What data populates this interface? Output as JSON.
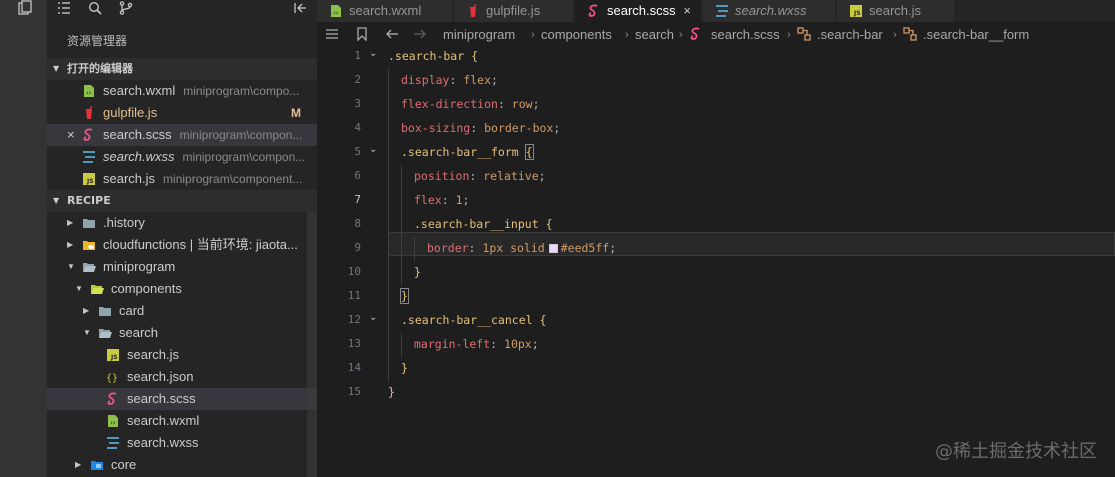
{
  "activity_bar": {
    "icons": [
      "files-icon",
      "list-icon",
      "search-icon",
      "source-control-icon"
    ]
  },
  "sidebar": {
    "title": "资源管理器",
    "open_editors_label": "打开的编辑器",
    "open_editors": [
      {
        "name": "search.wxml",
        "path": "miniprogram\\compo...",
        "icon": "wxml-icon"
      },
      {
        "name": "gulpfile.js",
        "path": "",
        "icon": "gulp-icon",
        "status": "M"
      },
      {
        "name": "search.scss",
        "path": "miniprogram\\compon...",
        "icon": "scss-icon",
        "close": "×"
      },
      {
        "name": "search.wxss",
        "path": "miniprogram\\compon...",
        "icon": "wxss-icon"
      },
      {
        "name": "search.js",
        "path": "miniprogram\\component...",
        "icon": "js-icon"
      }
    ],
    "project_label": "RECIPE",
    "tree": [
      {
        "name": ".history",
        "type": "folder",
        "expanded": false
      },
      {
        "name": "cloudfunctions | 当前环境: jiaota...",
        "type": "cloud-folder",
        "expanded": false
      },
      {
        "name": "miniprogram",
        "type": "folder",
        "expanded": true
      },
      {
        "name": "components",
        "type": "components-folder",
        "expanded": true
      },
      {
        "name": "card",
        "type": "folder",
        "expanded": false
      },
      {
        "name": "search",
        "type": "folder",
        "expanded": true
      },
      {
        "name": "search.js",
        "type": "js"
      },
      {
        "name": "search.json",
        "type": "json"
      },
      {
        "name": "search.scss",
        "type": "scss"
      },
      {
        "name": "search.wxml",
        "type": "wxml"
      },
      {
        "name": "search.wxss",
        "type": "wxss"
      },
      {
        "name": "core",
        "type": "core-folder",
        "expanded": false
      }
    ]
  },
  "tabs": [
    {
      "name": "search.wxml",
      "icon": "wxml-icon"
    },
    {
      "name": "gulpfile.js",
      "icon": "gulp-icon"
    },
    {
      "name": "search.scss",
      "icon": "scss-icon",
      "close": "×"
    },
    {
      "name": "search.wxss",
      "icon": "wxss-icon"
    },
    {
      "name": "search.js",
      "icon": "js-icon"
    }
  ],
  "breadcrumb": {
    "items": [
      "miniprogram",
      "components",
      "search",
      "search.scss",
      ".search-bar",
      ".search-bar__form"
    ]
  },
  "code": {
    "line_numbers": [
      "1",
      "2",
      "3",
      "4",
      "5",
      "6",
      "7",
      "8",
      "9",
      "10",
      "11",
      "12",
      "13",
      "14",
      "15"
    ],
    "lines": [
      [
        {
          "t": ".search-bar ",
          "c": "sel"
        },
        {
          "t": "{",
          "c": "brace"
        }
      ],
      [
        {
          "t": "display",
          "c": "prop"
        },
        {
          "t": ": ",
          "c": "pun"
        },
        {
          "t": "flex",
          "c": "val"
        },
        {
          "t": ";",
          "c": "pun"
        }
      ],
      [
        {
          "t": "flex-direction",
          "c": "prop"
        },
        {
          "t": ": ",
          "c": "pun"
        },
        {
          "t": "row",
          "c": "val"
        },
        {
          "t": ";",
          "c": "pun"
        }
      ],
      [
        {
          "t": "box-sizing",
          "c": "prop"
        },
        {
          "t": ": ",
          "c": "pun"
        },
        {
          "t": "border-box",
          "c": "val"
        },
        {
          "t": ";",
          "c": "pun"
        }
      ],
      [
        {
          "t": ".search-bar__form ",
          "c": "sel"
        },
        {
          "t": "{",
          "c": "brace"
        }
      ],
      [
        {
          "t": "position",
          "c": "prop"
        },
        {
          "t": ": ",
          "c": "pun"
        },
        {
          "t": "relative",
          "c": "val"
        },
        {
          "t": ";",
          "c": "pun"
        }
      ],
      [
        {
          "t": "flex",
          "c": "prop"
        },
        {
          "t": ": ",
          "c": "pun"
        },
        {
          "t": "1",
          "c": "val"
        },
        {
          "t": ";",
          "c": "pun"
        }
      ],
      [
        {
          "t": ".search-bar__input ",
          "c": "sel"
        },
        {
          "t": "{",
          "c": "brace"
        }
      ],
      [
        {
          "t": "border",
          "c": "prop"
        },
        {
          "t": ": ",
          "c": "pun"
        },
        {
          "t": "1px solid",
          "c": "val"
        },
        {
          "t": "#eed5ff",
          "c": "swatch-val"
        },
        {
          "t": ";",
          "c": "pun"
        }
      ],
      [
        {
          "t": "}",
          "c": "brace"
        }
      ],
      [
        {
          "t": "}",
          "c": "brace"
        }
      ],
      [
        {
          "t": ".search-bar__cancel ",
          "c": "sel"
        },
        {
          "t": "{",
          "c": "brace"
        }
      ],
      [
        {
          "t": "margin-left",
          "c": "prop"
        },
        {
          "t": ": ",
          "c": "pun"
        },
        {
          "t": "10px",
          "c": "val"
        },
        {
          "t": ";",
          "c": "pun"
        }
      ],
      [
        {
          "t": "}",
          "c": "brace"
        }
      ],
      [
        {
          "t": "}",
          "c": "brace"
        }
      ]
    ]
  },
  "watermark": "@稀土掘金技术社区"
}
